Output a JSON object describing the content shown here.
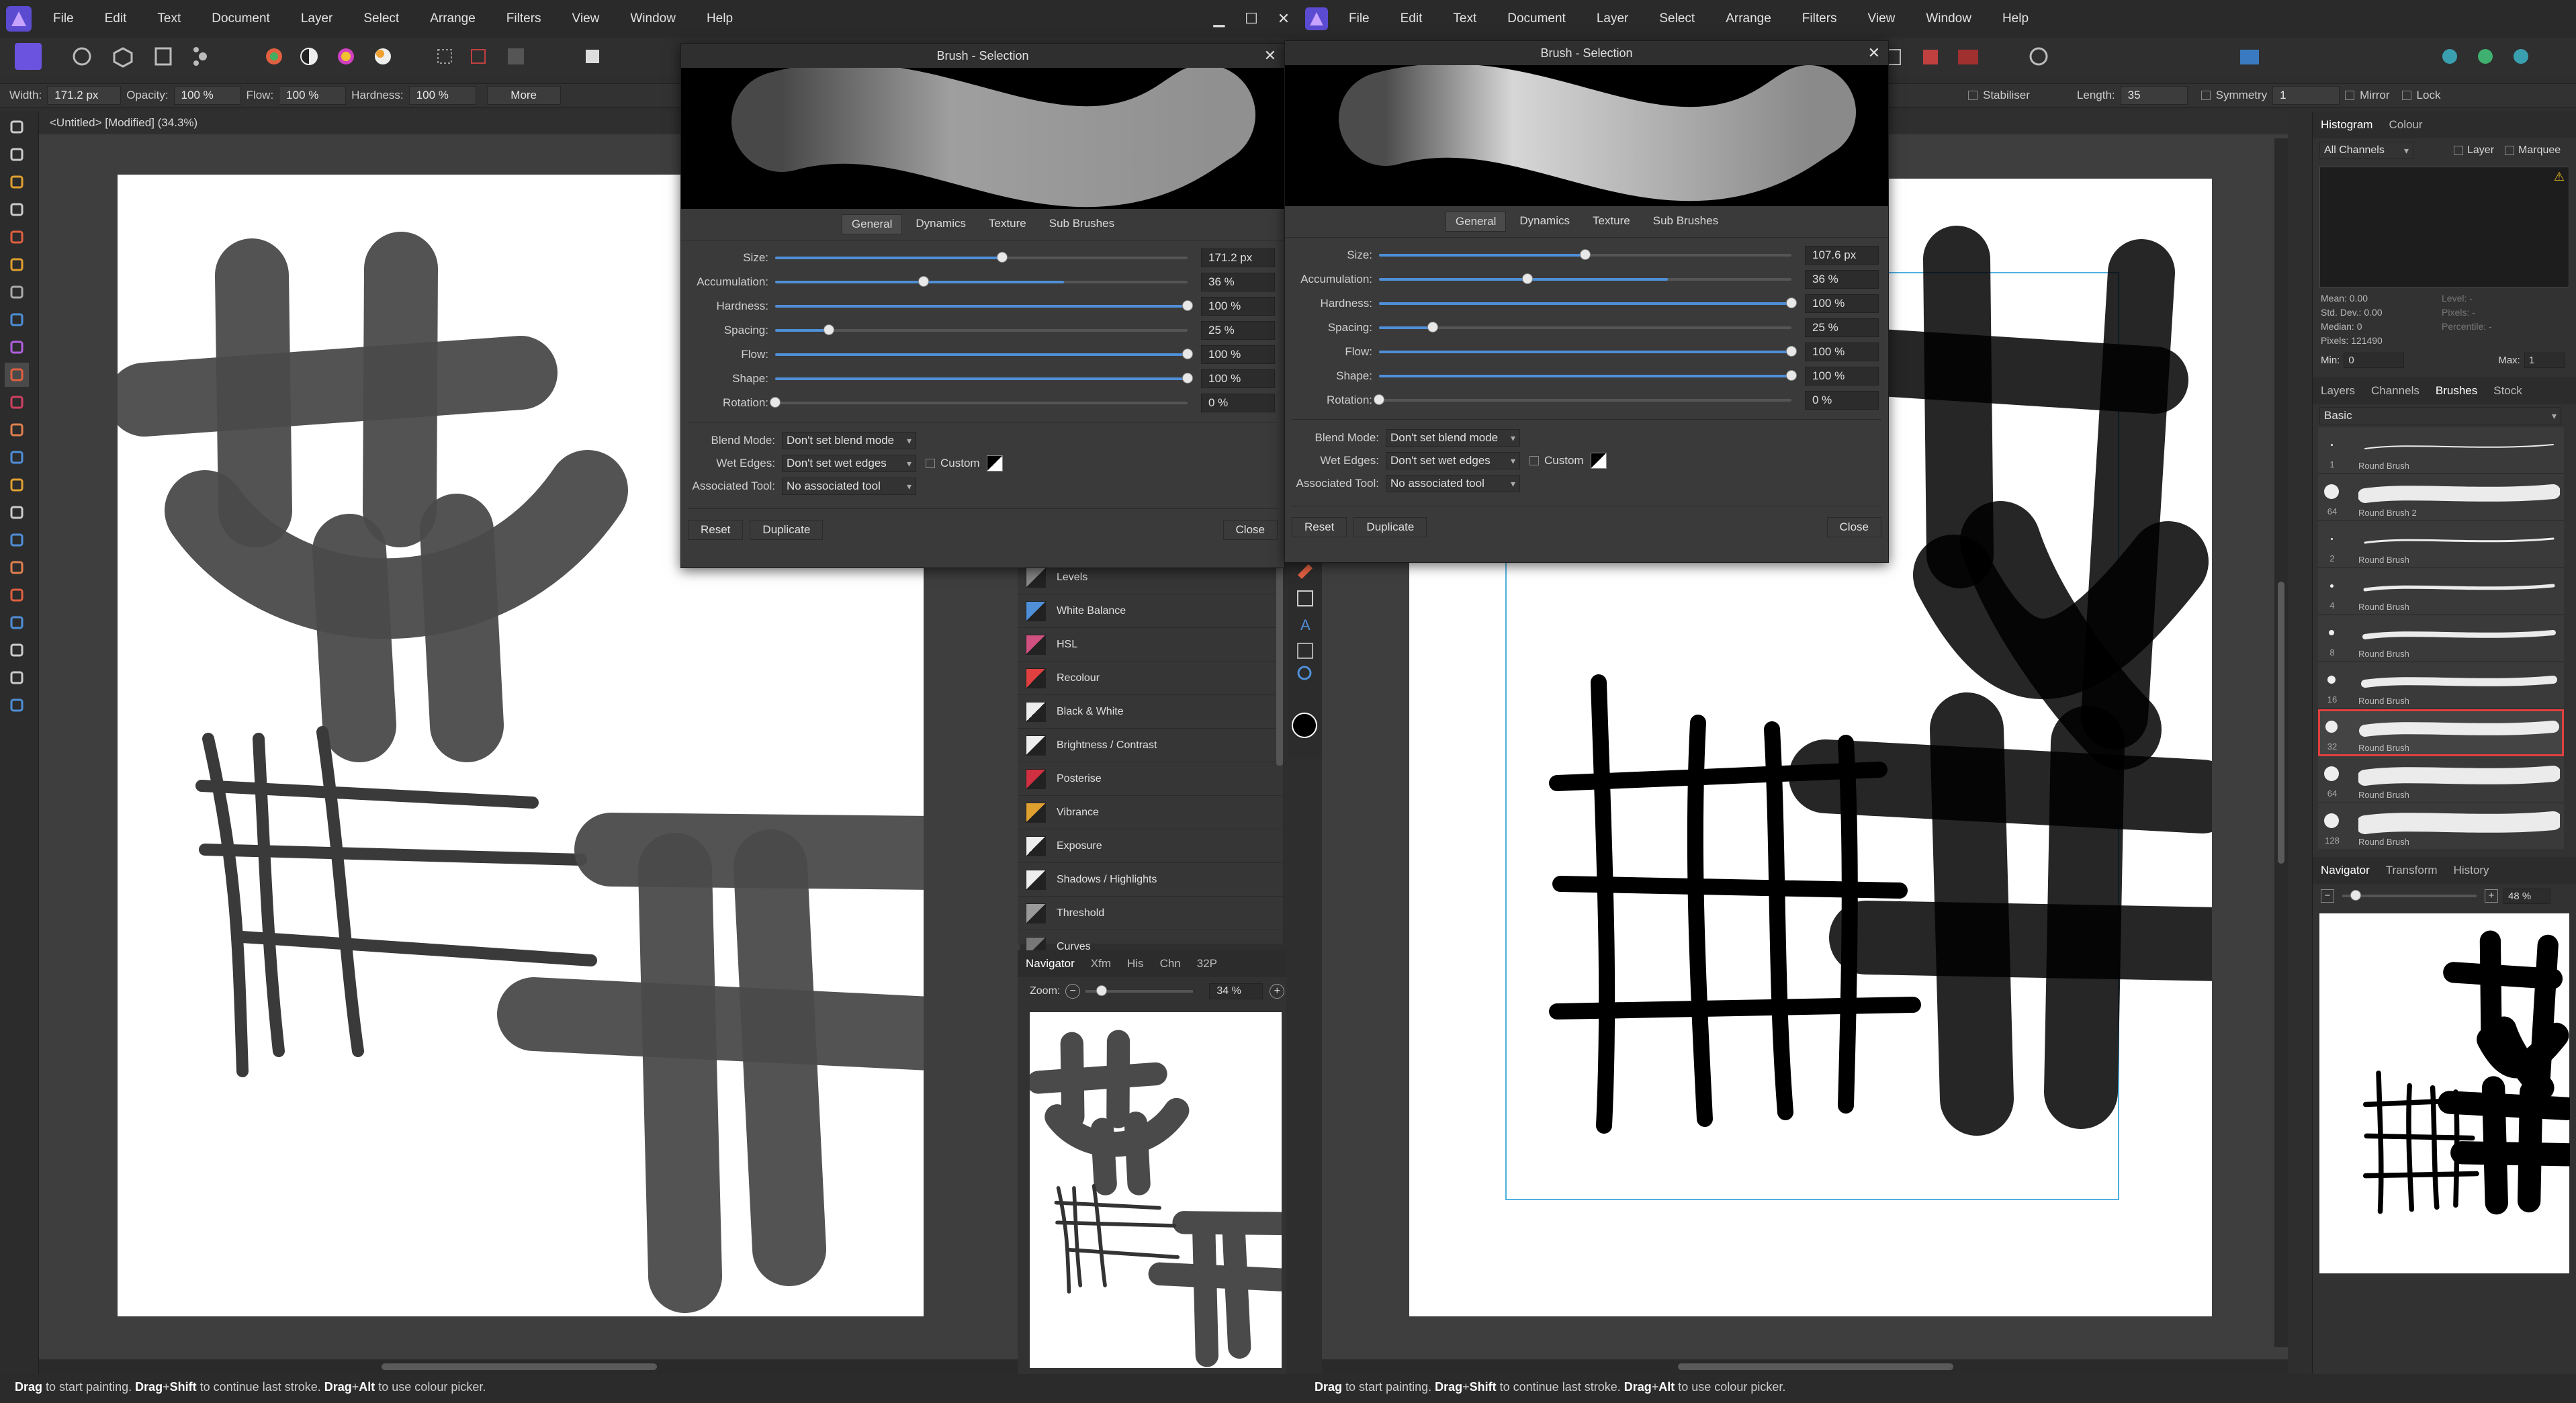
{
  "menu": {
    "items_left": [
      "File",
      "Edit",
      "Text",
      "Document",
      "Layer",
      "Select",
      "Arrange",
      "Filters",
      "View",
      "Window",
      "Help"
    ],
    "items_right": [
      "File",
      "Edit",
      "Text",
      "Document",
      "Layer",
      "Select",
      "Arrange",
      "Filters",
      "View",
      "Window",
      "Help"
    ],
    "win_min": "▁",
    "win_max": "☐",
    "win_close": "✕"
  },
  "context": {
    "width_label": "Width:",
    "width_value": "171.2 px",
    "opacity_label": "Opacity:",
    "opacity_value": "100 %",
    "flow_label": "Flow:",
    "flow_value": "100 %",
    "hardness_label": "Hardness:",
    "hardness_value": "100 %",
    "more_label": "More",
    "stabiliser_label": "Stabiliser",
    "length_label": "Length:",
    "length_value": "35",
    "symmetry_label": "Symmetry",
    "symmetry_value": "1",
    "mirror_label": "Mirror",
    "lock_label": "Lock"
  },
  "doc_title": "<Untitled> [Modified] (34.3%)",
  "dialog_left": {
    "title": "Brush - Selection",
    "tabs": [
      "General",
      "Dynamics",
      "Texture",
      "Sub Brushes"
    ],
    "sliders": [
      {
        "label": "Size:",
        "value": "171.2 px",
        "frac": 0.55,
        "fill": 0.55
      },
      {
        "label": "Accumulation:",
        "value": "36 %",
        "frac": 0.36,
        "fill": 0.7
      },
      {
        "label": "Hardness:",
        "value": "100 %",
        "frac": 1.0,
        "fill": 1.0
      },
      {
        "label": "Spacing:",
        "value": "25 %",
        "frac": 0.13,
        "fill": 0.13
      },
      {
        "label": "Flow:",
        "value": "100 %",
        "frac": 1.0,
        "fill": 1.0
      },
      {
        "label": "Shape:",
        "value": "100 %",
        "frac": 1.0,
        "fill": 1.0
      },
      {
        "label": "Rotation:",
        "value": "0 %",
        "frac": 0.0,
        "fill": 0.0
      }
    ],
    "blend_label": "Blend Mode:",
    "blend_value": "Don't set blend mode",
    "wet_label": "Wet Edges:",
    "wet_value": "Don't set wet edges",
    "custom_label": "Custom",
    "tool_label": "Associated Tool:",
    "tool_value": "No associated tool",
    "reset": "Reset",
    "duplicate": "Duplicate",
    "close": "Close"
  },
  "dialog_right": {
    "title": "Brush - Selection",
    "tabs": [
      "General",
      "Dynamics",
      "Texture",
      "Sub Brushes"
    ],
    "sliders": [
      {
        "label": "Size:",
        "value": "107.6 px",
        "frac": 0.5,
        "fill": 0.5
      },
      {
        "label": "Accumulation:",
        "value": "36 %",
        "frac": 0.36,
        "fill": 0.7
      },
      {
        "label": "Hardness:",
        "value": "100 %",
        "frac": 1.0,
        "fill": 1.0
      },
      {
        "label": "Spacing:",
        "value": "25 %",
        "frac": 0.13,
        "fill": 0.13
      },
      {
        "label": "Flow:",
        "value": "100 %",
        "frac": 1.0,
        "fill": 1.0
      },
      {
        "label": "Shape:",
        "value": "100 %",
        "frac": 1.0,
        "fill": 1.0
      },
      {
        "label": "Rotation:",
        "value": "0 %",
        "frac": 0.0,
        "fill": 0.0
      }
    ],
    "blend_label": "Blend Mode:",
    "blend_value": "Don't set blend mode",
    "wet_label": "Wet Edges:",
    "wet_value": "Don't set wet edges",
    "custom_label": "Custom",
    "tool_label": "Associated Tool:",
    "tool_value": "No associated tool",
    "reset": "Reset",
    "duplicate": "Duplicate",
    "close": "Close"
  },
  "adjustments": [
    {
      "label": "Levels",
      "color": "#888"
    },
    {
      "label": "White Balance",
      "color": "#4f8fd8"
    },
    {
      "label": "HSL",
      "color": "#d05080"
    },
    {
      "label": "Recolour",
      "color": "#e04040"
    },
    {
      "label": "Black & White",
      "color": "#eeeeee"
    },
    {
      "label": "Brightness / Contrast",
      "color": "#eeeeee"
    },
    {
      "label": "Posterise",
      "color": "#d03040"
    },
    {
      "label": "Vibrance",
      "color": "#e0a030"
    },
    {
      "label": "Exposure",
      "color": "#eeeeee"
    },
    {
      "label": "Shadows / Highlights",
      "color": "#eeeeee"
    },
    {
      "label": "Threshold",
      "color": "#999999"
    },
    {
      "label": "Curves",
      "color": "#777777"
    }
  ],
  "navigator_mid": {
    "tabs": [
      "Navigator",
      "Xfm",
      "His",
      "Chn",
      "32P"
    ],
    "zoom_label": "Zoom:",
    "zoom_value": "34 %",
    "zoom_frac": 0.15
  },
  "histogram": {
    "tabs": [
      "Histogram",
      "Colour"
    ],
    "channels": "All Channels",
    "layer_label": "Layer",
    "marquee_label": "Marquee",
    "stats_left": [
      "Mean: 0.00",
      "Std. Dev.: 0.00",
      "Median: 0",
      "Pixels: 121490"
    ],
    "stats_right": [
      "Level: -",
      "Pixels: -",
      "Percentile: -"
    ],
    "min_label": "Min:",
    "min_value": "0",
    "max_label": "Max:",
    "max_value": "1"
  },
  "brushes_panel": {
    "tabs": [
      "Layers",
      "Channels",
      "Brushes",
      "Stock"
    ],
    "category": "Basic",
    "items": [
      {
        "size": "1",
        "name": "Round Brush",
        "w": 2
      },
      {
        "size": "64",
        "name": "Round Brush 2",
        "w": 22
      },
      {
        "size": "2",
        "name": "Round Brush",
        "w": 3
      },
      {
        "size": "4",
        "name": "Round Brush",
        "w": 5
      },
      {
        "size": "8",
        "name": "Round Brush",
        "w": 8
      },
      {
        "size": "16",
        "name": "Round Brush",
        "w": 12
      },
      {
        "size": "32",
        "name": "Round Brush",
        "w": 18,
        "selected": true
      },
      {
        "size": "64",
        "name": "Round Brush",
        "w": 24
      },
      {
        "size": "128",
        "name": "Round Brush",
        "w": 28
      }
    ]
  },
  "navigator_right": {
    "tabs": [
      "Navigator",
      "Transform",
      "History"
    ],
    "zoom_value": "48 %",
    "zoom_frac": 0.1
  },
  "status_left": {
    "a": "Drag",
    "b": " to start painting. ",
    "c": "Drag",
    "d": "+",
    "e": "Shift",
    "f": " to continue last stroke. ",
    "g": "Drag",
    "h": "+",
    "i": "Alt",
    "j": " to use colour picker."
  },
  "status_right": {
    "a": "Drag",
    "b": " to start painting. ",
    "c": "Drag",
    "d": "+",
    "e": "Shift",
    "f": " to continue last stroke. ",
    "g": "Drag",
    "h": "+",
    "i": "Alt",
    "j": " to use colour picker."
  },
  "colors": {
    "accent": "#4f8fd8",
    "selected": "#e04040",
    "stroke_left": "#4a4a4a",
    "stroke_right": "#000000"
  }
}
